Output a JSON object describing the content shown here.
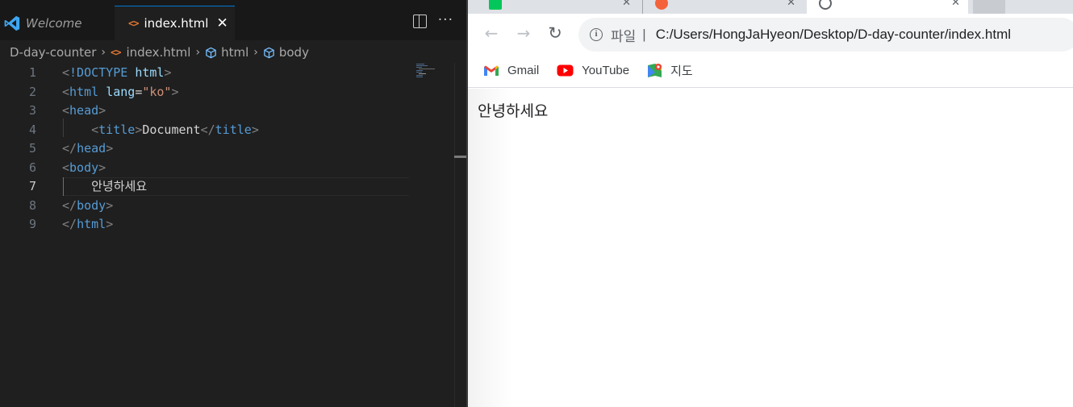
{
  "vscode": {
    "tabs": [
      {
        "label": "Welcome",
        "active": false
      },
      {
        "label": "index.html",
        "active": true,
        "close": "✕"
      }
    ],
    "actions": {
      "more": "···"
    },
    "breadcrumb": [
      "D-day-counter",
      "index.html",
      "html",
      "body"
    ],
    "breadcrumb_sep": "›",
    "code_lines": [
      {
        "n": "1",
        "tokens": [
          [
            "punc",
            "<"
          ],
          [
            "tag",
            "!DOCTYPE"
          ],
          [
            "text",
            " "
          ],
          [
            "attr",
            "html"
          ],
          [
            "punc",
            ">"
          ]
        ]
      },
      {
        "n": "2",
        "tokens": [
          [
            "punc",
            "<"
          ],
          [
            "tag",
            "html"
          ],
          [
            "text",
            " "
          ],
          [
            "attr",
            "lang"
          ],
          [
            "text",
            "="
          ],
          [
            "str",
            "\"ko\""
          ],
          [
            "punc",
            ">"
          ]
        ]
      },
      {
        "n": "3",
        "tokens": [
          [
            "punc",
            "<"
          ],
          [
            "tag",
            "head"
          ],
          [
            "punc",
            ">"
          ]
        ]
      },
      {
        "n": "4",
        "tokens": [
          [
            "text",
            "    "
          ],
          [
            "punc",
            "<"
          ],
          [
            "tag",
            "title"
          ],
          [
            "punc",
            ">"
          ],
          [
            "text",
            "Document"
          ],
          [
            "punc",
            "</"
          ],
          [
            "tag",
            "title"
          ],
          [
            "punc",
            ">"
          ]
        ]
      },
      {
        "n": "5",
        "tokens": [
          [
            "punc",
            "</"
          ],
          [
            "tag",
            "head"
          ],
          [
            "punc",
            ">"
          ]
        ]
      },
      {
        "n": "6",
        "tokens": [
          [
            "punc",
            "<"
          ],
          [
            "tag",
            "body"
          ],
          [
            "punc",
            ">"
          ]
        ]
      },
      {
        "n": "7",
        "tokens": [
          [
            "text",
            "    안녕하세요"
          ]
        ],
        "active": true
      },
      {
        "n": "8",
        "tokens": [
          [
            "punc",
            "</"
          ],
          [
            "tag",
            "body"
          ],
          [
            "punc",
            ">"
          ]
        ]
      },
      {
        "n": "9",
        "tokens": [
          [
            "punc",
            "</"
          ],
          [
            "tag",
            "html"
          ],
          [
            "punc",
            ">"
          ]
        ]
      }
    ],
    "colors": {
      "accent": "#0078d4",
      "tag": "#569cd6",
      "attr": "#9cdcfe",
      "string": "#ce9178",
      "html_icon": "#e37933"
    }
  },
  "chrome": {
    "tab_close": "✕",
    "nav": {
      "back": "←",
      "forward": "→",
      "reload": "↻"
    },
    "omnibox": {
      "info": "i",
      "scheme": "파일",
      "pipe": "|",
      "url": "C:/Users/HongJaHyeon/Desktop/D-day-counter/index.html"
    },
    "bookmarks": [
      {
        "label": "Gmail",
        "icon": "gmail-icon"
      },
      {
        "label": "YouTube",
        "icon": "youtube-icon"
      },
      {
        "label": "지도",
        "icon": "maps-icon"
      }
    ],
    "page": {
      "text": "안녕하세요"
    }
  }
}
